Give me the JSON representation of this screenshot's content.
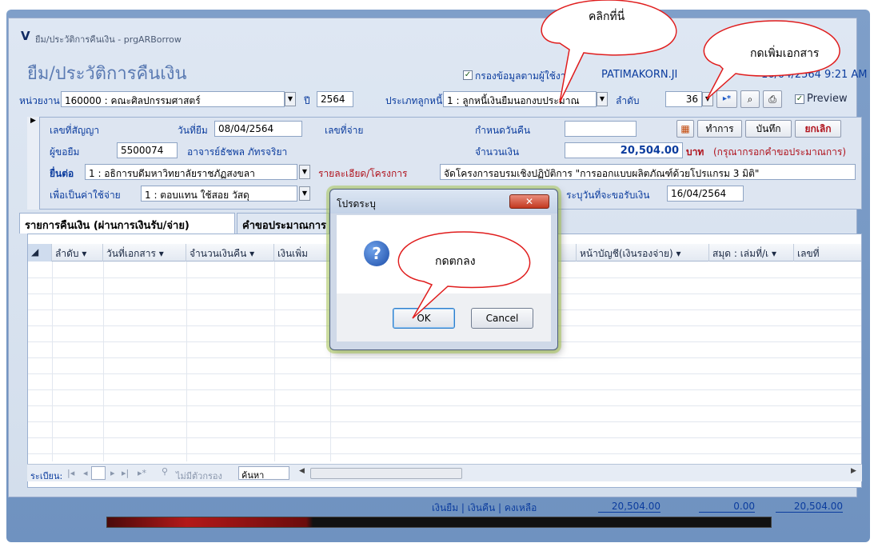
{
  "window": {
    "title": "ยืม/ประวัติการคืนเงิน - prgARBorrow",
    "logo": "V",
    "form_title": "ยืม/ประวัติการคืนเงิน"
  },
  "header": {
    "filter_label": "กรองข้อมูลตามผู้ใช้งาน",
    "filter_checked": true,
    "user": "PATIMAKORN.JI",
    "datetime": "16/04/2564 9:21 AM",
    "unit_label": "หน่วยงาน",
    "unit_value": "160000 : คณะศิลปกรรมศาสตร์",
    "year_label": "ปี",
    "year_value": "2564",
    "debtor_type_label": "ประเภทลูกหนี้",
    "debtor_type_value": "1 : ลูกหนี้เงินยืมนอกงบประมาณ",
    "order_label": "ลำดับ",
    "order_value": "36",
    "preview_label": "Preview",
    "preview_checked": true
  },
  "detail": {
    "contract_label": "เลขที่สัญญา",
    "contract_value": "",
    "borrow_date_label": "วันที่ยืม",
    "borrow_date_value": "08/04/2564",
    "payment_no_label": "เลขที่จ่าย",
    "payment_no_value": "",
    "due_date_label": "กำหนดวันคืน",
    "due_date_value": "",
    "process_btn": "ทำการ",
    "save_btn": "บันทึก",
    "cancel_btn": "ยกเลิก",
    "borrower_label": "ผู้ขอยืม",
    "borrower_code": "5500074",
    "borrower_name": "อาจารย์ธัชพล ภัทรจริยา",
    "amount_label": "จำนวนเงิน",
    "amount_value": "20,504.00",
    "amount_unit": "บาท",
    "amount_note": "(กรุณากรอกคำขอประมาณการ)",
    "submit_to_label": "ยื่นต่อ",
    "submit_to_value": "1 : อธิการบดีมหาวิทยาลัยราชภัฏสงขลา",
    "project_label": "รายละเอียด/โครงการ",
    "project_value": "จัดโครงการอบรมเชิงปฏิบัติการ \"การออกแบบผลิตภัณฑ์ด้วยโปรแกรม 3 มิติ\"",
    "purpose_label": "เพื่อเป็นค่าใช้จ่าย",
    "purpose_value": "1 : ตอบแทน ใช้สอย วัสดุ",
    "receive_date_label": "ระบุวันที่จะขอรับเงิน",
    "receive_date_value": "16/04/2564"
  },
  "tabs": [
    {
      "label": "รายการคืนเงิน (ผ่านการเงินรับ/จ่าย)"
    },
    {
      "label": "คำขอประมาณการ"
    }
  ],
  "grid": {
    "columns": [
      "ลำดับ",
      "วันที่เอกสาร",
      "จำนวนเงินคืน",
      "เงินเพิ่ม",
      "หน้าบัญชี(เงินรองจ่าย)",
      "สมุด : เล่มที่/เ",
      "เลขที่"
    ]
  },
  "nav": {
    "record_label": "ระเบียน:",
    "no_filter": "ไม่มีตัวกรอง",
    "search_label": "ค้นหา"
  },
  "summary": {
    "label": "เงินยืม | เงินคืน | คงเหลือ",
    "borrow": "20,504.00",
    "returned": "0.00",
    "balance": "20,504.00"
  },
  "dialog": {
    "title": "โปรดระบุ",
    "ok": "OK",
    "cancel": "Cancel"
  },
  "callouts": {
    "click_here": "คลิกที่นี่",
    "add_document": "กดเพิ่มเอกสาร",
    "press_ok": "กดตกลง"
  },
  "colors": {
    "label_blue": "#0b3c9e",
    "amount_red": "#b0121c",
    "callout_red": "#e01d1d"
  }
}
